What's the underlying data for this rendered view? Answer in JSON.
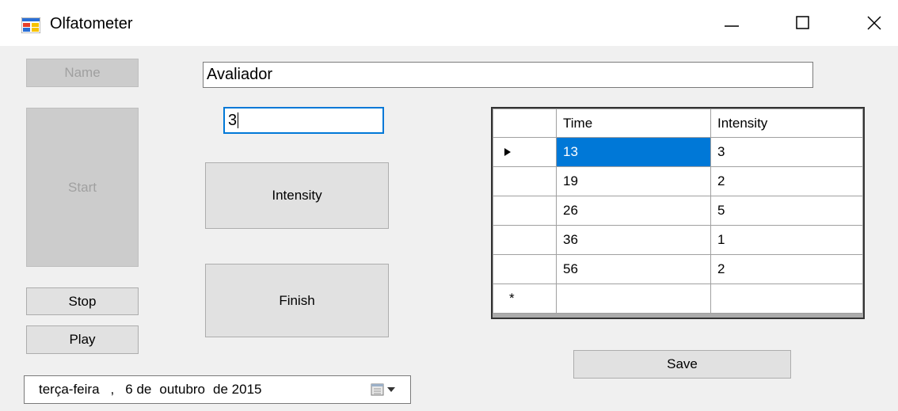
{
  "window": {
    "title": "Olfatometer",
    "icons": {
      "app": "app-form-icon",
      "minimize": "minimize-icon",
      "maximize": "maximize-icon",
      "close": "close-icon"
    }
  },
  "buttons": {
    "name": "Name",
    "start": "Start",
    "stop": "Stop",
    "play": "Play",
    "intensity": "Intensity",
    "finish": "Finish",
    "save": "Save"
  },
  "inputs": {
    "evaluator_value": "Avaliador",
    "intensity_value": "3"
  },
  "grid": {
    "columns": [
      "Time",
      "Intensity"
    ],
    "rows": [
      {
        "time": "13",
        "intensity": "3",
        "current": true
      },
      {
        "time": "19",
        "intensity": "2"
      },
      {
        "time": "26",
        "intensity": "5"
      },
      {
        "time": "36",
        "intensity": "1"
      },
      {
        "time": "56",
        "intensity": "2"
      }
    ],
    "new_row_marker": "*"
  },
  "date_picker": {
    "weekday": "terça-feira",
    "sep": ",",
    "day": "6 de",
    "month": "outubro",
    "year": "de 2015"
  },
  "colors": {
    "selection": "#0078d7",
    "focus_border": "#0078d7",
    "disabled_text": "#a0a0a0"
  }
}
